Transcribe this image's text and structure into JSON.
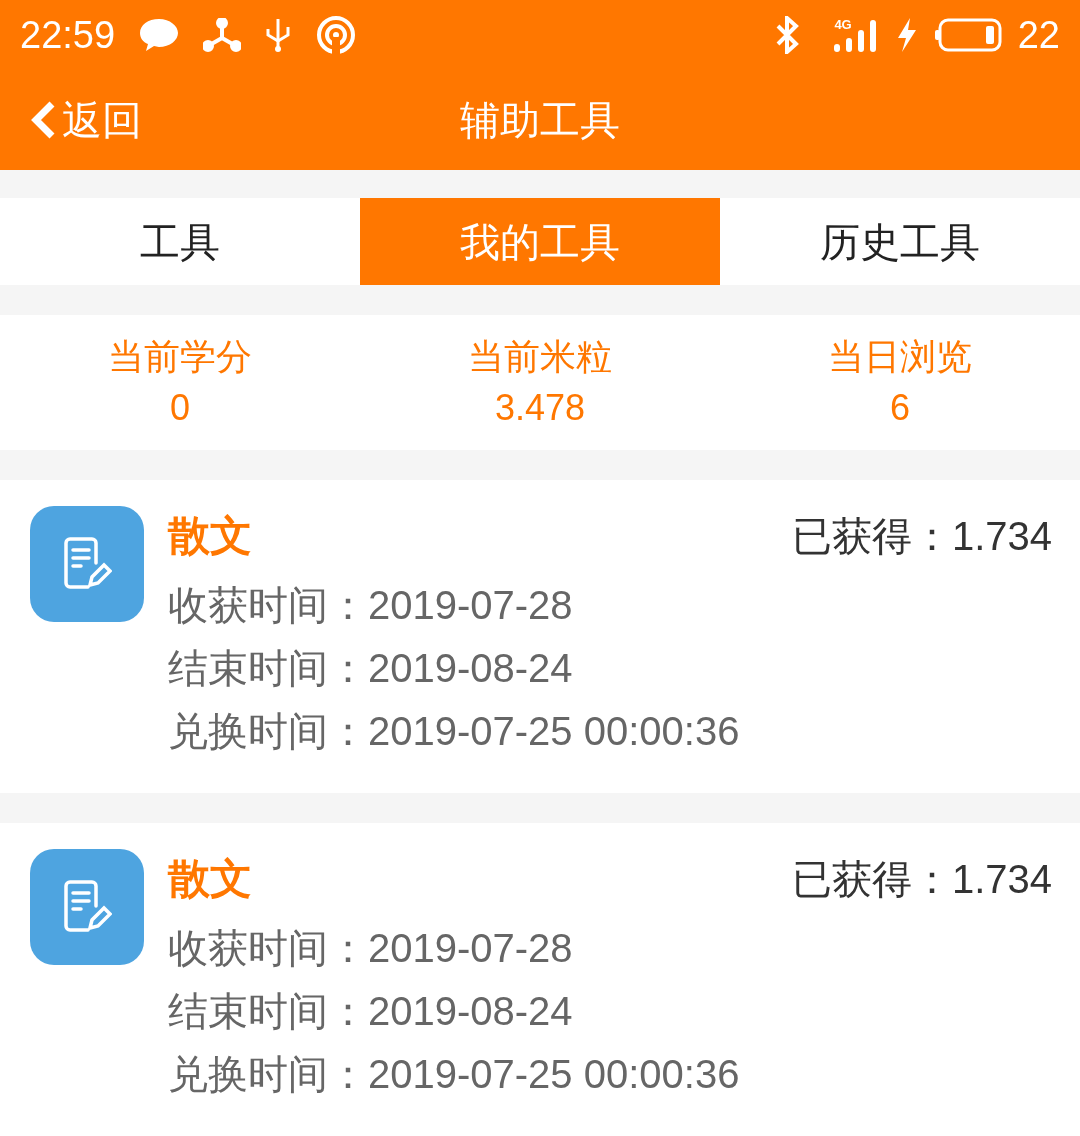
{
  "status_bar": {
    "time": "22:59",
    "network": "4G",
    "battery": "22"
  },
  "header": {
    "back": "返回",
    "title": "辅助工具"
  },
  "tabs": [
    {
      "label": "工具",
      "selected": false
    },
    {
      "label": "我的工具",
      "selected": true
    },
    {
      "label": "历史工具",
      "selected": false
    }
  ],
  "stats": [
    {
      "label": "当前学分",
      "value": "0"
    },
    {
      "label": "当前米粒",
      "value": "3.478"
    },
    {
      "label": "当日浏览",
      "value": "6"
    }
  ],
  "records": [
    {
      "title": "散文",
      "earned": "已获得：1.734",
      "lines": [
        "收获时间：2019-07-28",
        "结束时间：2019-08-24",
        "兑换时间：2019-07-25 00:00:36"
      ]
    },
    {
      "title": "散文",
      "earned": "已获得：1.734",
      "lines": [
        "收获时间：2019-07-28",
        "结束时间：2019-08-24",
        "兑换时间：2019-07-25 00:00:36"
      ]
    }
  ]
}
